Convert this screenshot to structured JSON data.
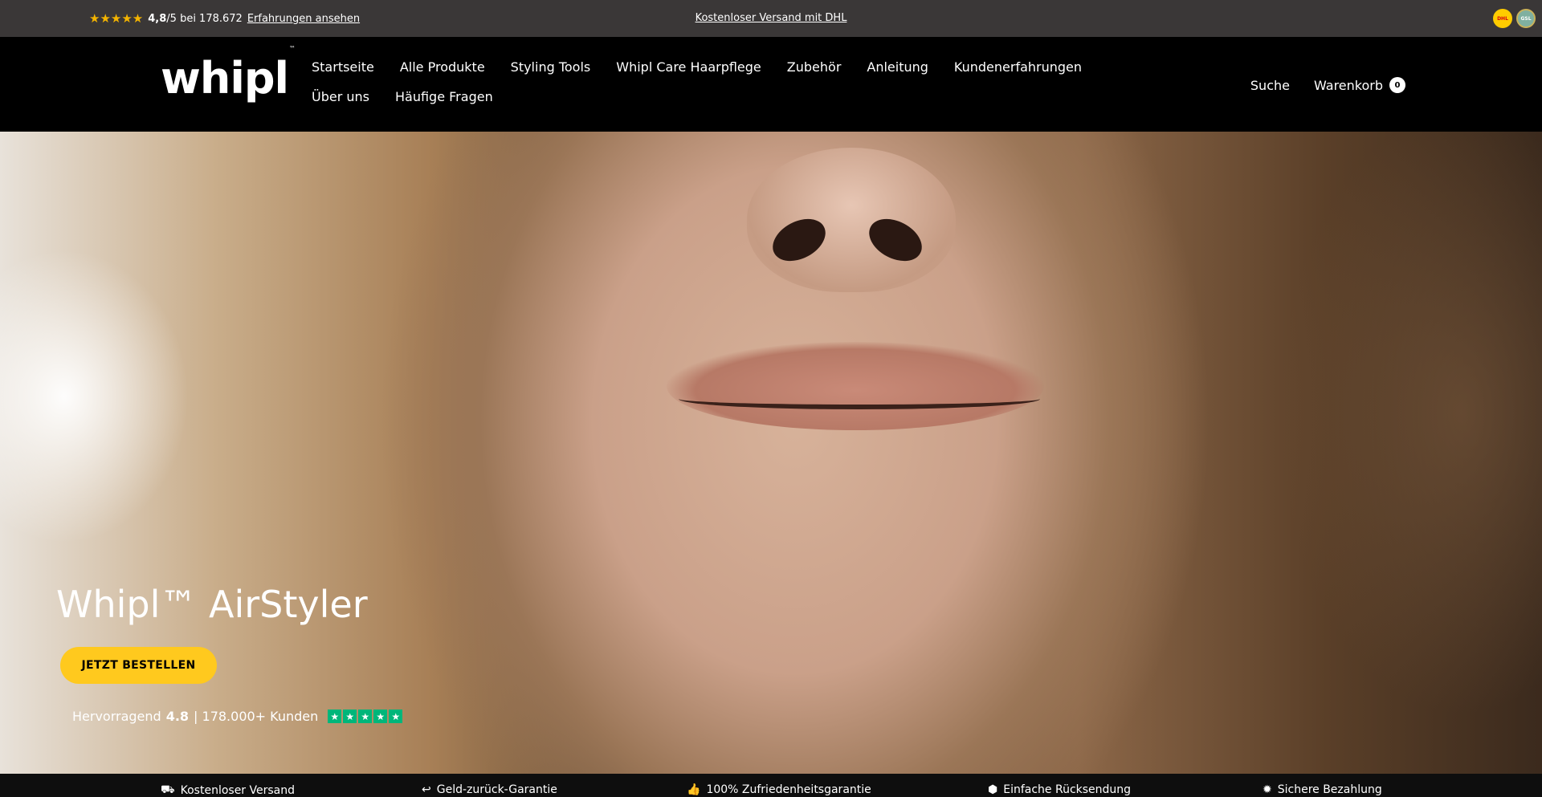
{
  "topbar": {
    "stars": "★★★★★",
    "rating_value": "4,8",
    "rating_suffix": "/5 bei 178.672",
    "reviews_link": "Erfahrungen ansehen",
    "shipping": "Kostenloser Versand mit DHL",
    "badge_dhl": "DHL",
    "badge_gsl": "GSL"
  },
  "header": {
    "logo": "whipl",
    "logo_tm": "™",
    "nav": [
      "Startseite",
      "Alle Produkte",
      "Styling Tools",
      "Whipl Care Haarpflege",
      "Zubehör",
      "Anleitung",
      "Kundenerfahrungen",
      "Über uns",
      "Häufige Fragen"
    ],
    "search": "Suche",
    "cart": "Warenkorb",
    "cart_count": "0"
  },
  "hero": {
    "title": "Whipl™ AirStyler",
    "cta": "JETZT BESTELLEN",
    "trust_prefix": "Hervorragend",
    "trust_score": "4.8",
    "trust_suffix": "| 178.000+ Kunden",
    "trust_star": "★"
  },
  "usp": [
    {
      "icon": "truck-icon",
      "label": "Kostenloser Versand"
    },
    {
      "icon": "return-arrow-icon",
      "label": "Geld-zurück-Garantie"
    },
    {
      "icon": "thumbs-up-icon",
      "label": "100% Zufriedenheitsgarantie"
    },
    {
      "icon": "box-icon",
      "label": "Einfache Rücksendung"
    },
    {
      "icon": "seal-icon",
      "label": "Sichere Bezahlung"
    }
  ]
}
